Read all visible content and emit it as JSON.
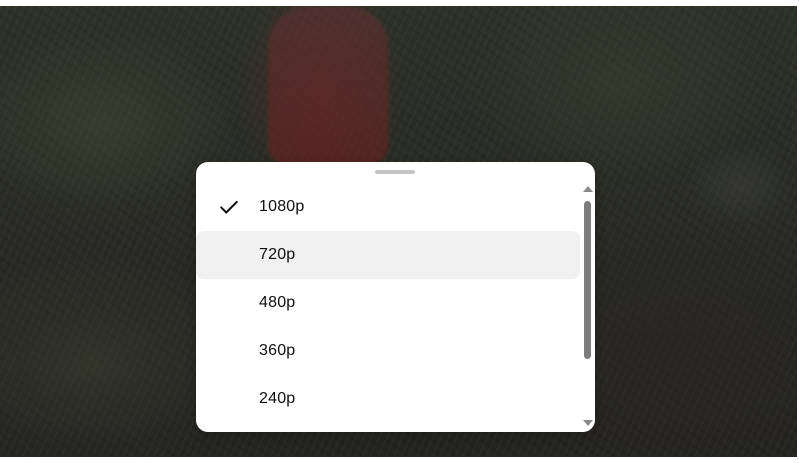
{
  "quality_menu": {
    "options": [
      {
        "label": "1080p",
        "selected": true
      },
      {
        "label": "720p",
        "selected": false
      },
      {
        "label": "480p",
        "selected": false
      },
      {
        "label": "360p",
        "selected": false
      },
      {
        "label": "240p",
        "selected": false
      }
    ],
    "selected_icon": "checkmark-icon",
    "highlight_color": "#f0f0f0"
  }
}
